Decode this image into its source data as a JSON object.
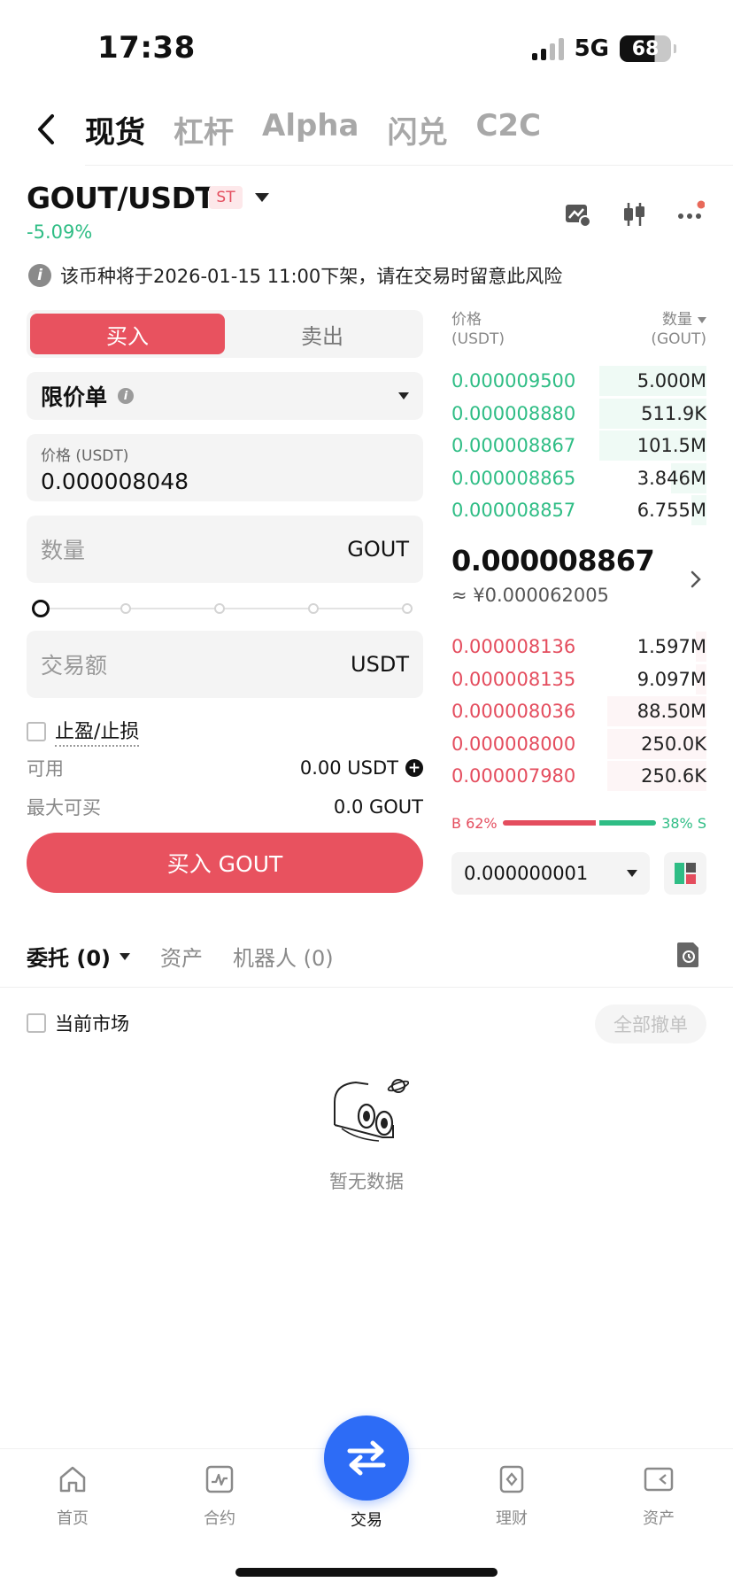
{
  "status_bar": {
    "time": "17:38",
    "network": "5G",
    "battery": "68"
  },
  "top_tabs": [
    {
      "label": "现货",
      "active": true
    },
    {
      "label": "杠杆",
      "active": false
    },
    {
      "label": "Alpha",
      "active": false
    },
    {
      "label": "闪兑",
      "active": false
    },
    {
      "label": "C2C",
      "active": false
    }
  ],
  "pair": {
    "symbol": "GOUT/USDT",
    "badge": "ST",
    "change": "-5.09%"
  },
  "notice": "该币种将于2026-01-15 11:00下架，请在交易时留意此风险",
  "trade_form": {
    "buy_label": "买入",
    "sell_label": "卖出",
    "order_type": "限价单",
    "price_caption": "价格 (USDT)",
    "price_value": "0.000008048",
    "qty_placeholder": "数量",
    "qty_unit": "GOUT",
    "amount_placeholder": "交易额",
    "amount_unit": "USDT",
    "tpsl_label": "止盈/止损",
    "available_label": "可用",
    "available_value": "0.00 USDT",
    "maxbuy_label": "最大可买",
    "maxbuy_value": "0.0 GOUT",
    "submit_label": "买入 GOUT"
  },
  "orderbook": {
    "price_header": "价格",
    "price_unit": "(USDT)",
    "qty_header": "数量",
    "qty_unit": "(GOUT)",
    "top_rows": [
      {
        "price": "0.000009500",
        "qty": "5.000M",
        "depth": 0.42
      },
      {
        "price": "0.000008880",
        "qty": "511.9K",
        "depth": 0.42
      },
      {
        "price": "0.000008867",
        "qty": "101.5M",
        "depth": 0.42
      },
      {
        "price": "0.000008865",
        "qty": "3.846M",
        "depth": 0.14
      },
      {
        "price": "0.000008857",
        "qty": "6.755M",
        "depth": 0.06
      }
    ],
    "mid_price": "0.000008867",
    "mid_cny": "≈ ¥0.000062005",
    "bottom_rows": [
      {
        "price": "0.000008136",
        "qty": "1.597M",
        "depth": 0.04
      },
      {
        "price": "0.000008135",
        "qty": "9.097M",
        "depth": 0.04
      },
      {
        "price": "0.000008036",
        "qty": "88.50M",
        "depth": 0.39
      },
      {
        "price": "0.000008000",
        "qty": "250.0K",
        "depth": 0.39
      },
      {
        "price": "0.000007980",
        "qty": "250.6K",
        "depth": 0.39
      }
    ],
    "buy_ratio_label": "B 62%",
    "sell_ratio_label": "38% S",
    "buy_ratio": 62,
    "sell_ratio": 38,
    "precision": "0.000000001"
  },
  "orders": {
    "tabs": [
      {
        "label": "委托 (0)",
        "active": true
      },
      {
        "label": "资产",
        "active": false
      },
      {
        "label": "机器人 (0)",
        "active": false
      }
    ],
    "current_market_label": "当前市场",
    "cancel_all_label": "全部撤单",
    "empty_text": "暂无数据"
  },
  "bottom_nav": [
    {
      "label": "首页",
      "icon": "home-icon",
      "active": false
    },
    {
      "label": "合约",
      "icon": "contract-chart-icon",
      "active": false
    },
    {
      "label": "交易",
      "icon": "swap-arrows-icon",
      "active": true
    },
    {
      "label": "理财",
      "icon": "finance-icon",
      "active": false
    },
    {
      "label": "资产",
      "icon": "wallet-icon",
      "active": false
    }
  ],
  "colors": {
    "buy_red": "#e8525f",
    "ask_red": "#e44d5e",
    "bid_green": "#2fbd85",
    "accent_blue": "#2d6cf6"
  }
}
